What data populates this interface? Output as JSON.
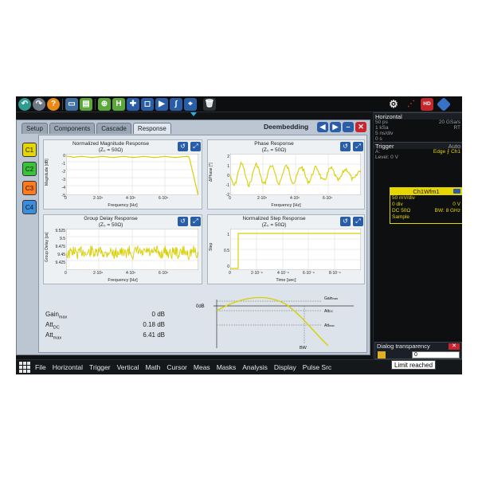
{
  "dialog": {
    "tabs": [
      "Setup",
      "Components",
      "Cascade",
      "Response"
    ],
    "active_tab": "Response",
    "title": "Deembedding"
  },
  "channels": [
    "C1",
    "C2",
    "C3",
    "C4"
  ],
  "channel_colors": [
    "#e6d600",
    "#39c339",
    "#ff7a1a",
    "#3b8de0"
  ],
  "plots": {
    "magnitude": {
      "title": "Normalized Magnitude Response",
      "subtitle": "(Z₀ = 50Ω)",
      "ylabel": "Magnitude [dB]",
      "xlabel": "Frequency [Hz]",
      "yticks": [
        "0",
        "-1",
        "-2",
        "-3",
        "-4",
        "-5"
      ],
      "xticks": [
        "0",
        "2·10⁹",
        "4·10⁹",
        "6·10⁹"
      ]
    },
    "phase": {
      "title": "Phase Response",
      "subtitle": "(Z₀ = 50Ω)",
      "ylabel": "ΔPhase [°]",
      "xlabel": "Frequency [Hz]",
      "yticks": [
        "2",
        "1",
        "0",
        "-1",
        "-2"
      ],
      "xticks": [
        "0",
        "2·10⁹",
        "4·10⁹",
        "6·10⁹"
      ]
    },
    "group_delay": {
      "title": "Group Delay Response",
      "subtitle": "(Z₀ = 50Ω)",
      "ylabel": "Group Delay [ps]",
      "xlabel": "Frequency [Hz]",
      "yticks": [
        "9.525",
        "9.5",
        "9.475",
        "9.45",
        "9.425"
      ],
      "xticks": [
        "0",
        "2·10⁹",
        "4·10⁹",
        "6·10⁹"
      ]
    },
    "step": {
      "title": "Normalized Step Response",
      "subtitle": "(Z₀ = 50Ω)",
      "ylabel": "Step",
      "xlabel": "Time [sec]",
      "yticks": [
        "1",
        "0.5",
        "0"
      ],
      "xticks": [
        "0",
        "2·10⁻⁹",
        "4·10⁻⁹",
        "6·10⁻⁹",
        "8·10⁻⁹"
      ]
    }
  },
  "stats": [
    {
      "label": "Gain",
      "sub": "max",
      "value": "0 dB"
    },
    {
      "label": "Att",
      "sub": "DC",
      "value": "0.18 dB"
    },
    {
      "label": "Att",
      "sub": "max",
      "value": "6.41 dB"
    }
  ],
  "diagram": {
    "zero_db": "0dB",
    "gain_max": "Gain",
    "gain_max_sub": "max",
    "att_dc": "Att",
    "att_dc_sub": "DC",
    "att_max": "Att",
    "att_max_sub": "max",
    "bw": "BW"
  },
  "right_panel": {
    "horizontal_title": "Horizontal",
    "h_rows": [
      [
        "50 ps",
        "20 GSa/s"
      ],
      [
        "1 kSa",
        "RT"
      ],
      [
        "5 ns/div",
        ""
      ],
      [
        "0 s",
        ""
      ]
    ],
    "trigger_title": "Trigger",
    "trigger_label": "Auto",
    "t_rows": [
      [
        "A:",
        "Edge  ⨍ Ch1"
      ],
      [
        "Level: 0 V",
        ""
      ]
    ],
    "channel_box": {
      "title": "Ch1Wfm1",
      "rows": [
        [
          "50 mV/div",
          ""
        ],
        [
          "0 div",
          "0 V"
        ],
        [
          "DC 50Ω",
          "BW: 8 GHz"
        ],
        [
          "Sample",
          ""
        ]
      ]
    }
  },
  "bottom_menu": [
    "File",
    "Horizontal",
    "Trigger",
    "Vertical",
    "Math",
    "Cursor",
    "Meas",
    "Masks",
    "Analysis",
    "Display",
    "Pulse Src"
  ],
  "transparency": {
    "title": "Dialog transparency",
    "value": "0"
  },
  "tooltip": "Limit reached"
}
